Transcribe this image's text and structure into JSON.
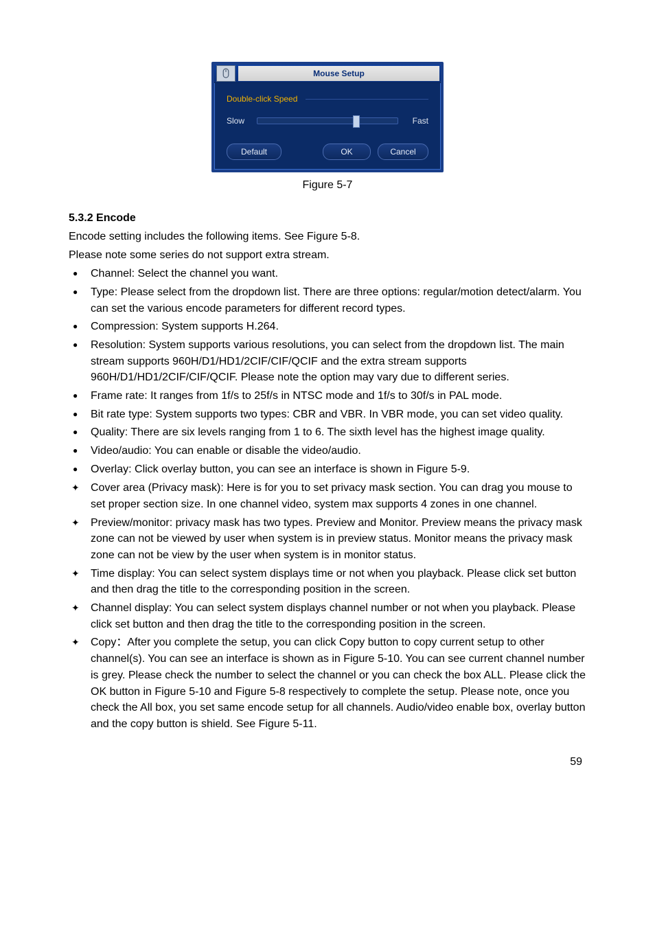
{
  "dialog": {
    "title": "Mouse Setup",
    "section_label": "Double-click Speed",
    "slow_label": "Slow",
    "fast_label": "Fast",
    "btn_default": "Default",
    "btn_ok": "OK",
    "btn_cancel": "Cancel"
  },
  "caption": "Figure 5-7",
  "heading": "5.3.2  Encode",
  "intro1": "Encode setting includes the following items. See Figure 5-8.",
  "intro2": "Please note some series do not support extra stream.",
  "bullets": [
    "Channel: Select the channel you want.",
    "Type: Please select from the dropdown list. There are three options: regular/motion detect/alarm. You can set the various encode parameters for different record types.",
    "Compression: System supports H.264.",
    "Resolution: System supports various resolutions, you can select from the dropdown list. The main stream supports 960H/D1/HD1/2CIF/CIF/QCIF and the extra stream supports 960H/D1/HD1/2CIF/CIF/QCIF. Please note the option may vary due to different series.",
    "Frame rate: It ranges from 1f/s to 25f/s in NTSC mode and 1f/s to 30f/s in PAL mode.",
    "Bit rate type: System supports two types: CBR and VBR. In VBR mode, you can set video quality.",
    "Quality: There are six levels ranging from 1 to 6. The sixth level has the highest image quality.",
    "Video/audio: You can enable or disable the video/audio.",
    "Overlay: Click overlay button, you can see an interface is shown in Figure 5-9."
  ],
  "diamonds": [
    "Cover area (Privacy mask): Here is for you to set privacy mask section. You can drag you mouse to set proper section size. In one channel video, system max supports 4 zones in one channel.",
    "Preview/monitor: privacy mask has two types. Preview and Monitor. Preview means the privacy mask zone can not be viewed by user when system is in preview status. Monitor means the privacy mask zone can not be view by the user when system is in monitor status.",
    "Time display: You can select system displays time or not when you playback. Please click set button and then drag the title to the corresponding position in the screen.",
    "Channel display: You can select system displays channel number or not when you playback. Please click set button and then drag the title to the corresponding position in the screen.",
    "Copy：After you complete the setup, you can click Copy button to copy current setup to other channel(s). You can see an interface is shown as in Figure 5-10. You can see current channel number is grey. Please check the number to select the channel or you can check the box ALL. Please click the OK button in Figure 5-10 and Figure 5-8 respectively to complete the setup. Please note, once you check the All box, you set same encode setup for all channels. Audio/video enable box, overlay button and the copy button is shield. See Figure 5-11."
  ],
  "page_number": "59"
}
